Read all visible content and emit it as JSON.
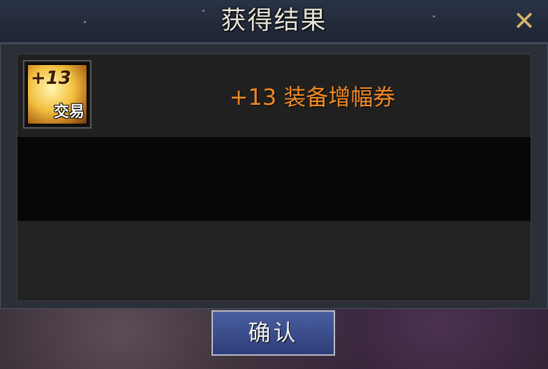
{
  "dialog": {
    "title": "获得结果",
    "close_label": "✕",
    "confirm_label": "确认"
  },
  "reward": {
    "icon_plus_text": "+13",
    "icon_tag": "交易",
    "item_name": "+13 装备增幅券"
  },
  "icons": {
    "close": "close-icon",
    "item": "amplify-ticket-icon"
  },
  "colors": {
    "item_name": "#f08a24",
    "button": "#3a4c8c"
  }
}
